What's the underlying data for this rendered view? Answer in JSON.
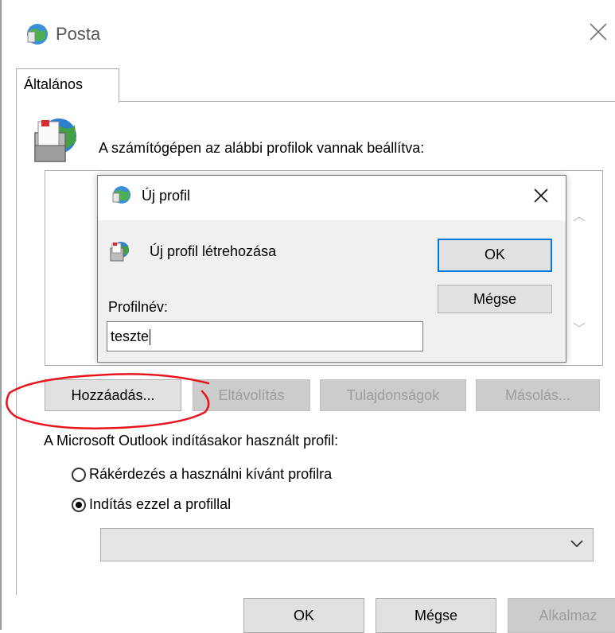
{
  "window": {
    "title": "Posta",
    "tab": "Általános",
    "heading": "A számítógépen az alábbi profilok vannak beállítva:",
    "buttons": {
      "add": "Hozzáadás...",
      "remove": "Eltávolítás",
      "properties": "Tulajdonságok",
      "copy": "Másolás..."
    },
    "startup_label": "A Microsoft Outlook indításakor használt profil:",
    "radio_prompt": "Rákérdezés a használni kívánt profilra",
    "radio_use": "Indítás ezzel a profillal",
    "selected_radio": "use",
    "ok": "OK",
    "cancel": "Mégse",
    "apply": "Alkalmaz"
  },
  "dialog": {
    "title": "Új profil",
    "create_text": "Új profil létrehozása",
    "ok": "OK",
    "cancel": "Mégse",
    "name_label": "Profilnév:",
    "name_value": "teszte"
  },
  "icons": [
    "mail-icon",
    "close-icon",
    "profiles-icon",
    "chevron-down-icon",
    "scroll-up-icon",
    "scroll-down-icon"
  ],
  "colors": {
    "accent": "#0078d7",
    "annotation": "#e8141b",
    "button_bg": "#e1e1e1",
    "dialog_bg": "#f0f0f0"
  }
}
